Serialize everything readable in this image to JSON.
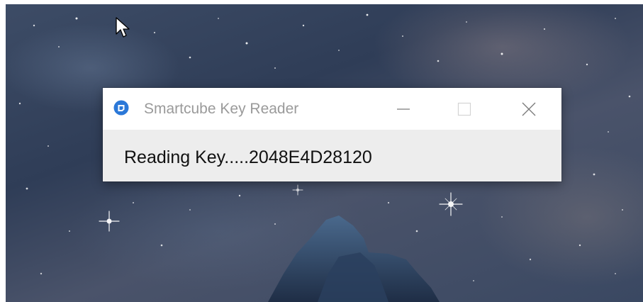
{
  "window": {
    "title": "Smartcube Key Reader",
    "message": "Reading Key.....2048E4D28120",
    "controls": {
      "minimize_icon": "minimize-icon",
      "maximize_icon": "maximize-icon",
      "close_icon": "close-icon"
    }
  },
  "colors": {
    "titlebar_bg": "#ffffff",
    "window_bg": "#ededed",
    "title_text": "#9a9a9a",
    "accent_icon": "#2b78d8"
  }
}
